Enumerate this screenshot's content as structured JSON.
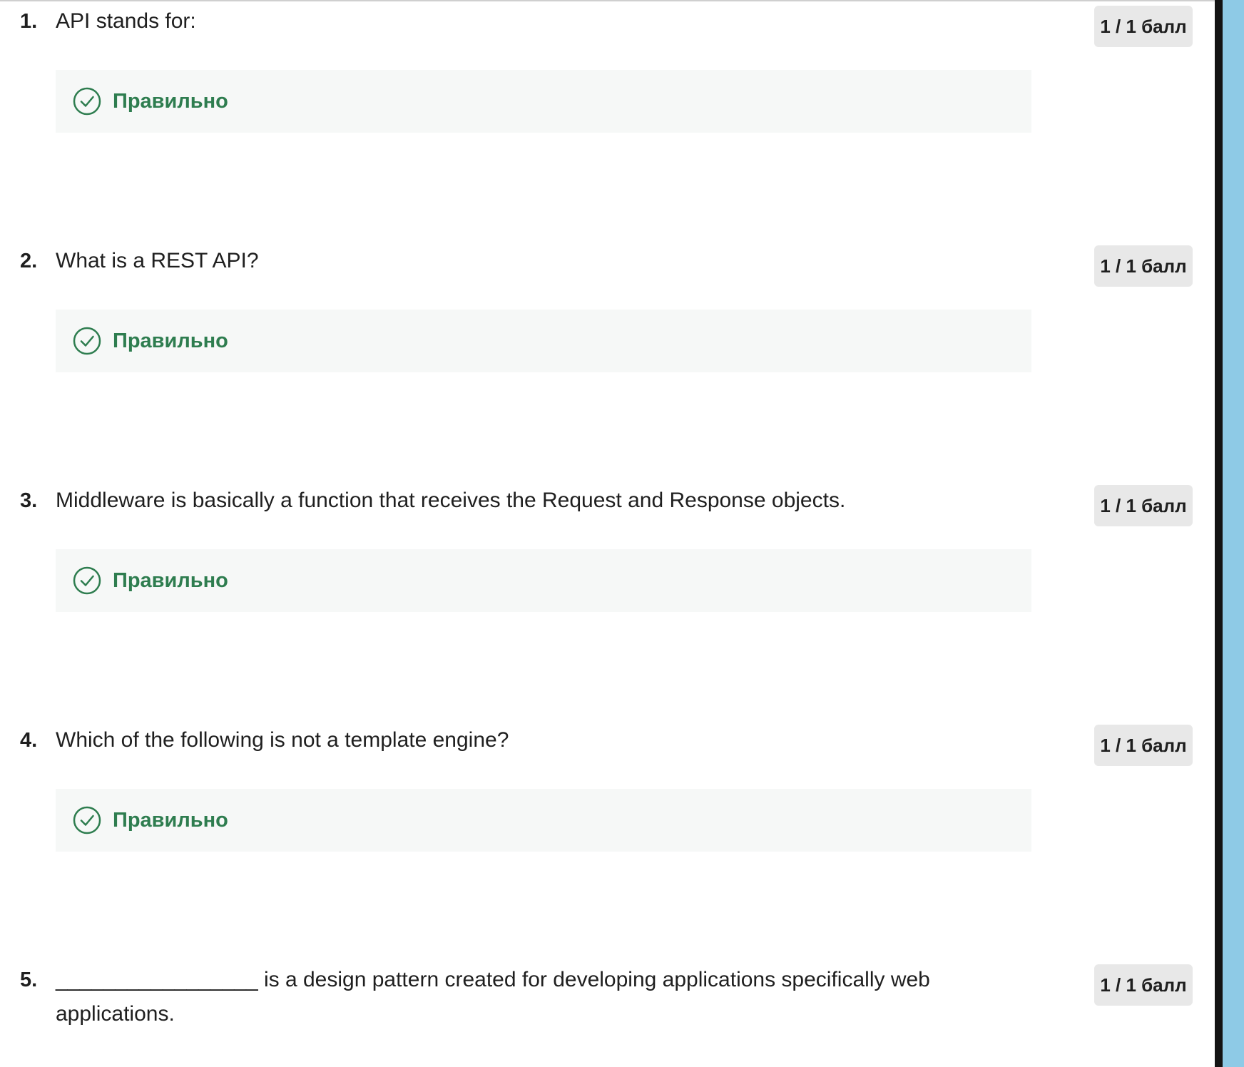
{
  "questions": [
    {
      "number": "1.",
      "text": "API stands for:",
      "score": "1 / 1 балл",
      "feedback": "Правильно"
    },
    {
      "number": "2.",
      "text": "What is a REST API?",
      "score": "1 / 1 балл",
      "feedback": "Правильно"
    },
    {
      "number": "3.",
      "text": "Middleware is basically a function that receives the Request and Response objects.",
      "score": "1 / 1 балл",
      "feedback": "Правильно"
    },
    {
      "number": "4.",
      "text": "Which of the following is not a template engine?",
      "score": "1 / 1 балл",
      "feedback": "Правильно"
    },
    {
      "number": "5.",
      "text": "_________________ is a design pattern created for developing applications specifically web applications.",
      "score": "1 / 1 балл"
    }
  ],
  "colors": {
    "correct_green": "#2e7d4f",
    "feedback_background": "#f6f8f7",
    "badge_background": "#e8e8e8",
    "scrollbar_accent": "#8ecae6"
  },
  "icons": {
    "feedback": "check-circle-icon"
  }
}
